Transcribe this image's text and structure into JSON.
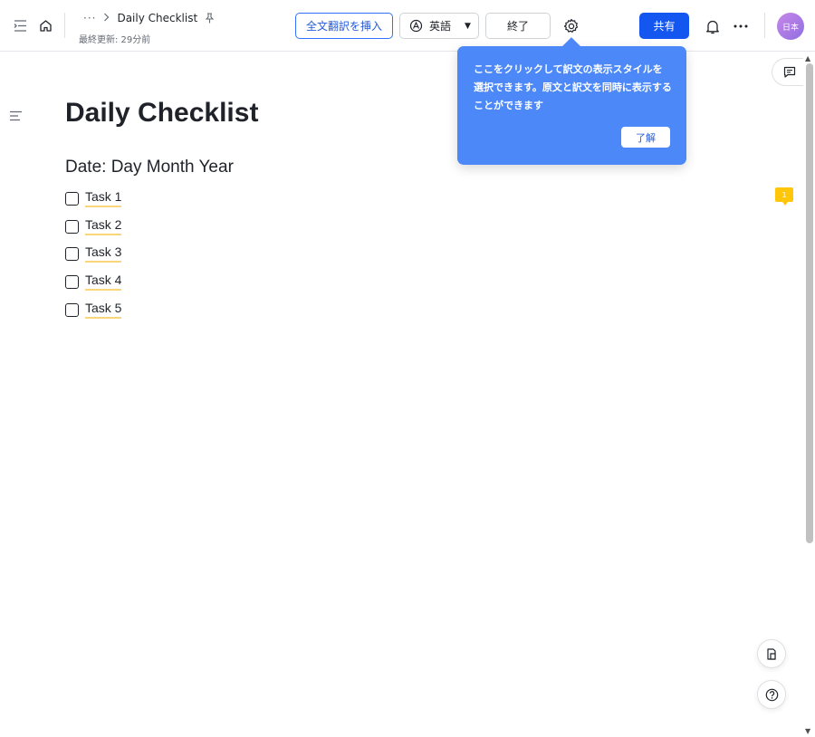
{
  "header": {
    "breadcrumb_more": "···",
    "breadcrumb_title": "Daily Checklist",
    "last_updated": "最終更新: 29分前",
    "insert_translation_label": "全文翻訳を挿入",
    "language_label": "英語",
    "end_label": "終了",
    "share_label": "共有",
    "avatar_text": "日本"
  },
  "tooltip": {
    "message": "ここをクリックして訳文の表示スタイルを選択できます。原文と訳文を同時に表示することができます",
    "ok_label": "了解"
  },
  "document": {
    "title": "Daily Checklist",
    "subtitle": "Date: Day Month Year",
    "tasks": [
      {
        "label": "Task 1",
        "checked": false
      },
      {
        "label": "Task 2",
        "checked": false
      },
      {
        "label": "Task 3",
        "checked": false
      },
      {
        "label": "Task 4",
        "checked": false
      },
      {
        "label": "Task 5",
        "checked": false
      }
    ]
  },
  "comments": {
    "badge_count": "1"
  },
  "colors": {
    "primary": "#1456f0",
    "tooltip_bg": "#4c88f7",
    "highlight_underline": "#f9d67a",
    "comment_badge": "#ffc60a"
  },
  "icons": [
    "sidebar-toggle-icon",
    "home-icon",
    "chevron-right-icon",
    "pin-icon",
    "translate-icon",
    "caret-down-icon",
    "settings-gear-icon",
    "bell-icon",
    "more-horizontal-icon",
    "outline-list-icon",
    "comment-icon",
    "document-copy-icon",
    "help-icon"
  ]
}
